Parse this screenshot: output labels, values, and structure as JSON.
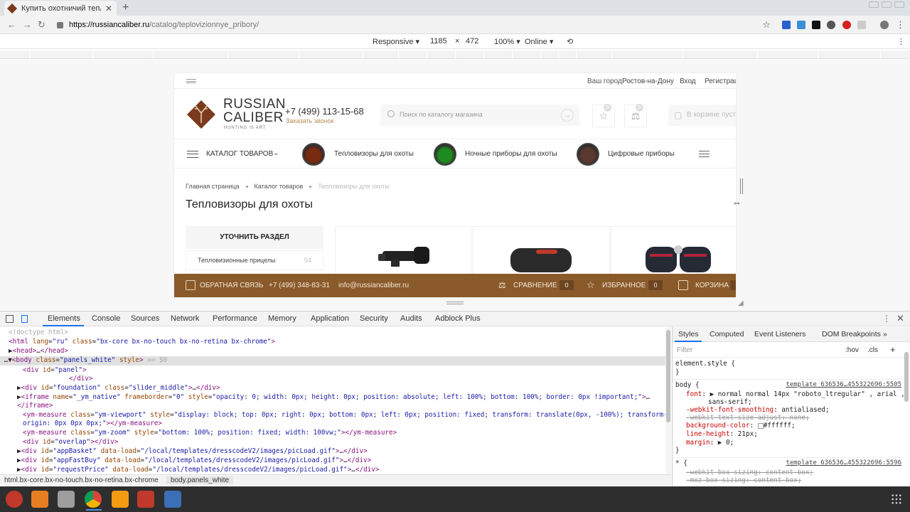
{
  "browser": {
    "tab_title": "Купить охотничий тепловизор",
    "tab_close": "✕",
    "new_tab": "+",
    "url_host": "https://russiancaliber.ru",
    "url_path": "/catalog/teplovizionnye_pribory/",
    "back": "←",
    "forward": "→",
    "reload": "↻",
    "star": "☆",
    "menu": "⋮"
  },
  "device_toolbar": {
    "mode": "Responsive ▾",
    "width": "1185",
    "times": "×",
    "height": "472",
    "zoom": "100% ▾",
    "network": "Online ▾",
    "rotate": "⟲",
    "menu": "⋮"
  },
  "site": {
    "city_label": "Ваш город:",
    "city": "Ростов-на-Дону",
    "login": "Вход",
    "register": "Регистрация",
    "logo_line1": "RUSSIAN",
    "logo_line2": "CALIBER",
    "logo_sub": "HUNTING IS ART",
    "phone": "+7 (499) 113-15-68",
    "callback": "Заказать звонок",
    "search_placeholder": "Поиск по каталогу магазина",
    "search_go": "→",
    "fav_count": "0",
    "compare_count": "0",
    "cart_text": "В корзине пусто",
    "catalog_label": "КАТАЛОГ ТОВАРОВ",
    "catalog_chevron": "⌄",
    "menu": [
      {
        "label": "Тепловизоры для охоты",
        "color": "#7a2a10"
      },
      {
        "label": "Ночные приборы для охоты",
        "color": "#1f8a1f"
      },
      {
        "label": "Цифровые приборы",
        "color": "#5a3a30"
      }
    ],
    "breadcrumbs": [
      "Главная страница",
      "Каталог товаров",
      "Тепловизоры для охоты"
    ],
    "page_title": "Тепловизоры для охоты",
    "sidebar_title": "УТОЧНИТЬ РАЗДЕЛ",
    "sidebar_item": "Тепловизионные прицелы",
    "sidebar_count": "54",
    "footer": {
      "feedback": "ОБРАТНАЯ СВЯЗЬ",
      "phone": "+7 (499) 348-83-31",
      "email": "info@russiancaliber.ru",
      "compare": "СРАВНЕНИЕ",
      "compare_count": "0",
      "favorites": "ИЗБРАННОЕ",
      "favorites_count": "0",
      "cart": "КОРЗИНА"
    },
    "brand_color": "#8a5a2b"
  },
  "devtools": {
    "tabs": [
      "Elements",
      "Console",
      "Sources",
      "Network",
      "Performance",
      "Memory",
      "Application",
      "Security",
      "Audits",
      "Adblock Plus"
    ],
    "active_tab": "Elements",
    "more": "⋮",
    "close": "✕",
    "breadcrumb1": "html.bx-core.bx-no-touch.bx-no-retina.bx-chrome",
    "breadcrumb2": "body.panels_white",
    "styles_tabs": [
      "Styles",
      "Computed",
      "Event Listeners",
      "DOM Breakpoints",
      "»"
    ],
    "filter_placeholder": "Filter",
    "hov": ":hov",
    "cls": ".cls",
    "plus": "+",
    "src1": "template_636536…455322696:5505",
    "src2": "template_636536…455322696:5596"
  }
}
